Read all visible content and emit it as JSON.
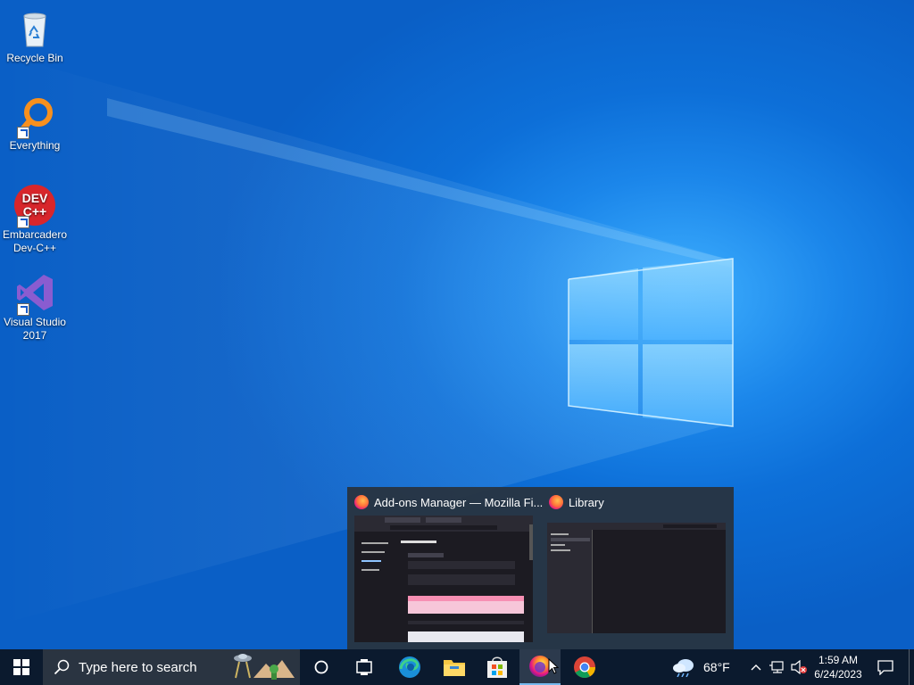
{
  "desktop": {
    "icons": [
      {
        "label": "Recycle Bin",
        "icon": "recycle-bin-icon"
      },
      {
        "label": "Everything",
        "icon": "everything-search-icon"
      },
      {
        "label": "Embarcadero Dev-C++",
        "icon": "devcpp-icon"
      },
      {
        "label": "Visual Studio 2017",
        "icon": "visual-studio-icon"
      }
    ],
    "devcpp_icon_text": "DEV C++"
  },
  "thumbnails": [
    {
      "title": "Add-ons Manager — Mozilla Fi...",
      "icon": "firefox-icon"
    },
    {
      "title": "Library",
      "icon": "firefox-icon"
    }
  ],
  "taskbar": {
    "search_placeholder": "Type here to search",
    "apps": [
      "cortana-icon",
      "task-view-icon",
      "edge-icon",
      "file-explorer-icon",
      "microsoft-store-icon",
      "firefox-icon",
      "chrome-icon"
    ],
    "active_app": "firefox-icon"
  },
  "tray": {
    "weather_temp": "68°F",
    "time": "1:59 AM",
    "date": "6/24/2023"
  },
  "colors": {
    "taskbar": "#0b1a2e",
    "accent": "#0a63c9"
  }
}
